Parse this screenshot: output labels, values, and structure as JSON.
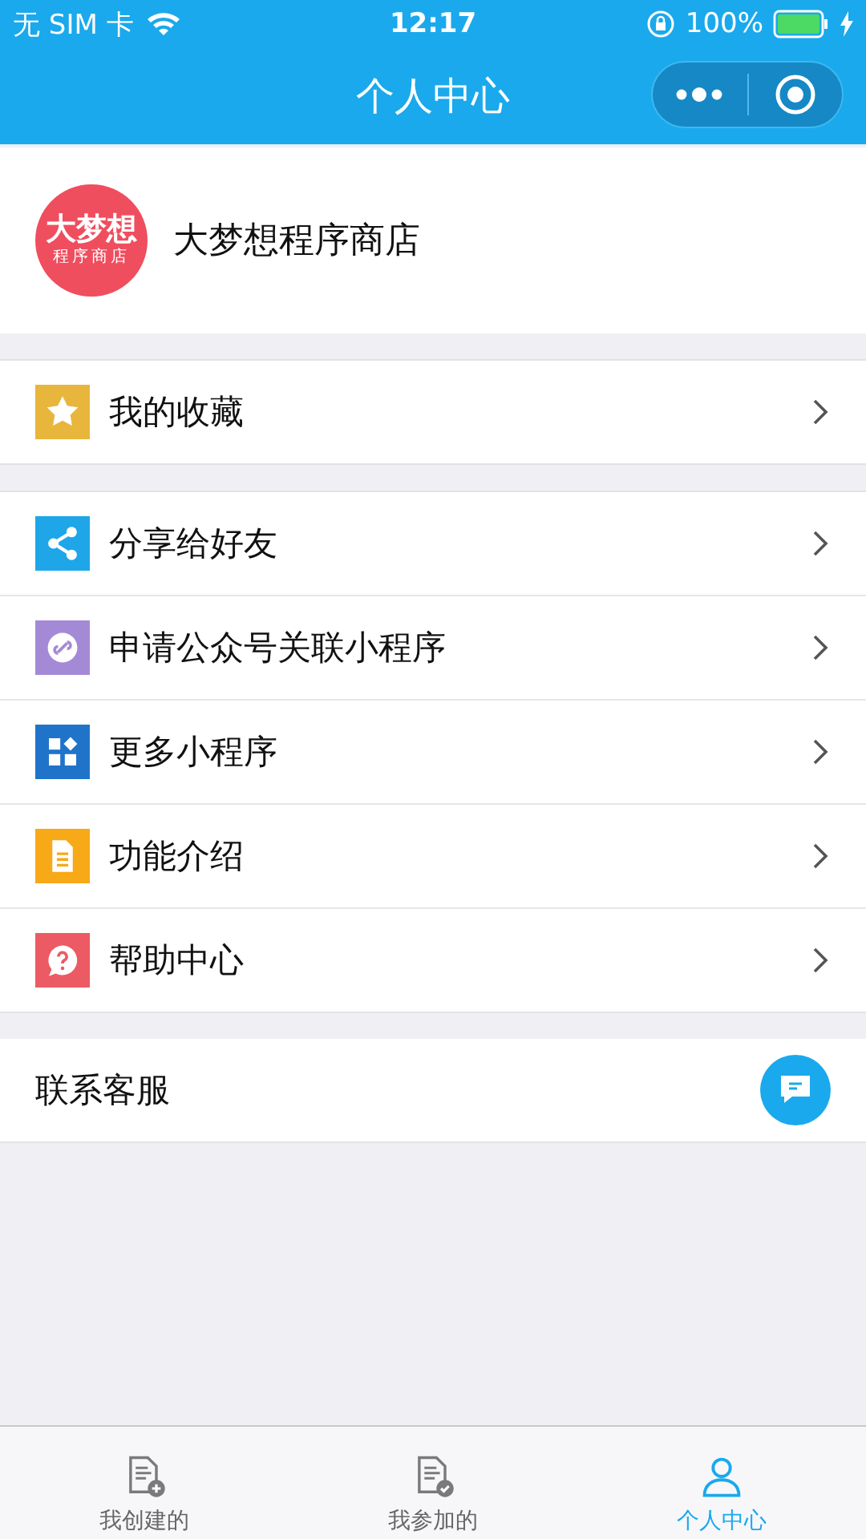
{
  "status_bar": {
    "carrier": "无 SIM 卡",
    "time": "12:17",
    "battery": "100%"
  },
  "nav_bar": {
    "title": "个人中心"
  },
  "profile": {
    "logo_line1": "大梦想",
    "logo_line2": "程序商店",
    "name": "大梦想程序商店"
  },
  "menu_groups": [
    [
      {
        "kind": "star",
        "color": "#e8b63c",
        "label": "我的收藏"
      }
    ],
    [
      {
        "kind": "share",
        "color": "#1ea6e9",
        "label": "分享给好友"
      },
      {
        "kind": "link",
        "color": "#a48ad6",
        "label": "申请公众号关联小程序"
      },
      {
        "kind": "grid",
        "color": "#1f74c9",
        "label": "更多小程序"
      },
      {
        "kind": "doc",
        "color": "#f7a917",
        "label": "功能介绍"
      },
      {
        "kind": "help",
        "color": "#ec5a63",
        "label": "帮助中心"
      }
    ]
  ],
  "contact": {
    "label": "联系客服"
  },
  "tab_bar": [
    {
      "kind": "doc-add",
      "label": "我创建的",
      "selected": false
    },
    {
      "kind": "doc-check",
      "label": "我参加的",
      "selected": false
    },
    {
      "kind": "person",
      "label": "个人中心",
      "selected": true
    }
  ]
}
